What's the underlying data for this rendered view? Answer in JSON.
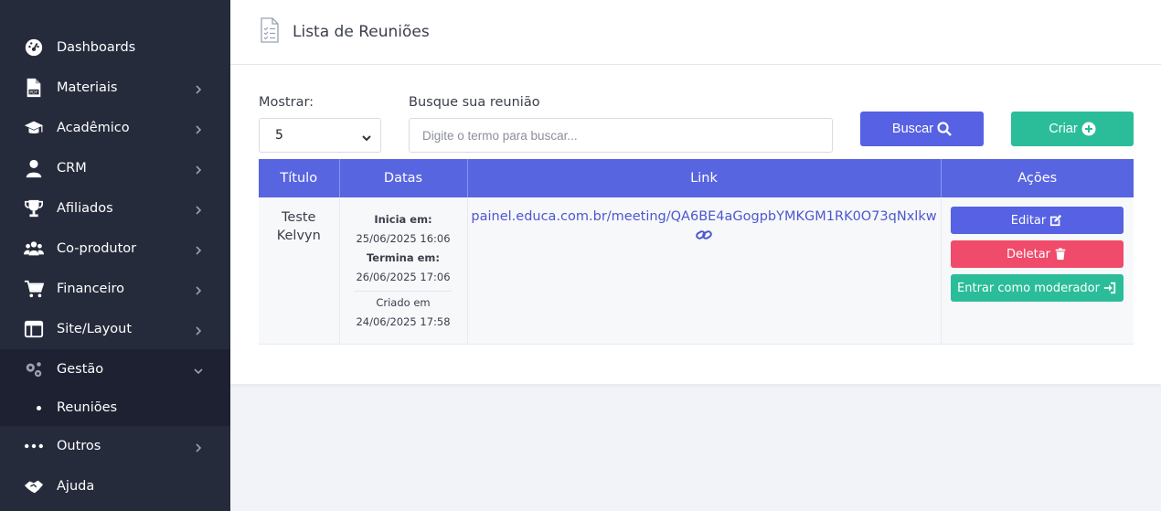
{
  "sidebar": {
    "items": [
      {
        "label": "Dashboards",
        "icon": "dashboard-icon"
      },
      {
        "label": "Materiais",
        "icon": "pdf-file-icon"
      },
      {
        "label": "Acadêmico",
        "icon": "graduation-cap-icon"
      },
      {
        "label": "CRM",
        "icon": "user-icon"
      },
      {
        "label": "Afiliados",
        "icon": "trophy-icon"
      },
      {
        "label": "Co-produtor",
        "icon": "users-icon"
      },
      {
        "label": "Financeiro",
        "icon": "cart-icon"
      },
      {
        "label": "Site/Layout",
        "icon": "layout-icon"
      },
      {
        "label": "Gestão",
        "icon": "gears-icon"
      },
      {
        "label": "Outros",
        "icon": "more-icon"
      },
      {
        "label": "Ajuda",
        "icon": "handshake-icon"
      }
    ],
    "sub_items": [
      {
        "label": "Reuniões"
      }
    ]
  },
  "header": {
    "title": "Lista de Reuniões"
  },
  "controls": {
    "show_label": "Mostrar:",
    "show_value": "5",
    "search_label": "Busque sua reunião",
    "search_placeholder": "Digite o termo para buscar...",
    "search_value": "",
    "search_button": "Buscar",
    "create_button": "Criar"
  },
  "table": {
    "headers": [
      "Título",
      "Datas",
      "Link",
      "Ações"
    ],
    "rows": [
      {
        "title": "Teste Kelvyn",
        "starts_label": "Inicia em:",
        "starts_value": "25/06/2025 16:06",
        "ends_label": "Termina em:",
        "ends_value": "26/06/2025 17:06",
        "created_label": "Criado em",
        "created_value": "24/06/2025 17:58",
        "link": "painel.educa.com.br/meeting/QA6BE4aGogpbYMKGM1RK0O73qNxlkw",
        "edit": "Editar",
        "delete": "Deletar",
        "moderator": "Entrar como moderador"
      }
    ]
  },
  "colors": {
    "sidebar_bg": "#262b3c",
    "primary": "#5661e3",
    "success": "#2bbd99",
    "danger": "#f04b6a"
  }
}
